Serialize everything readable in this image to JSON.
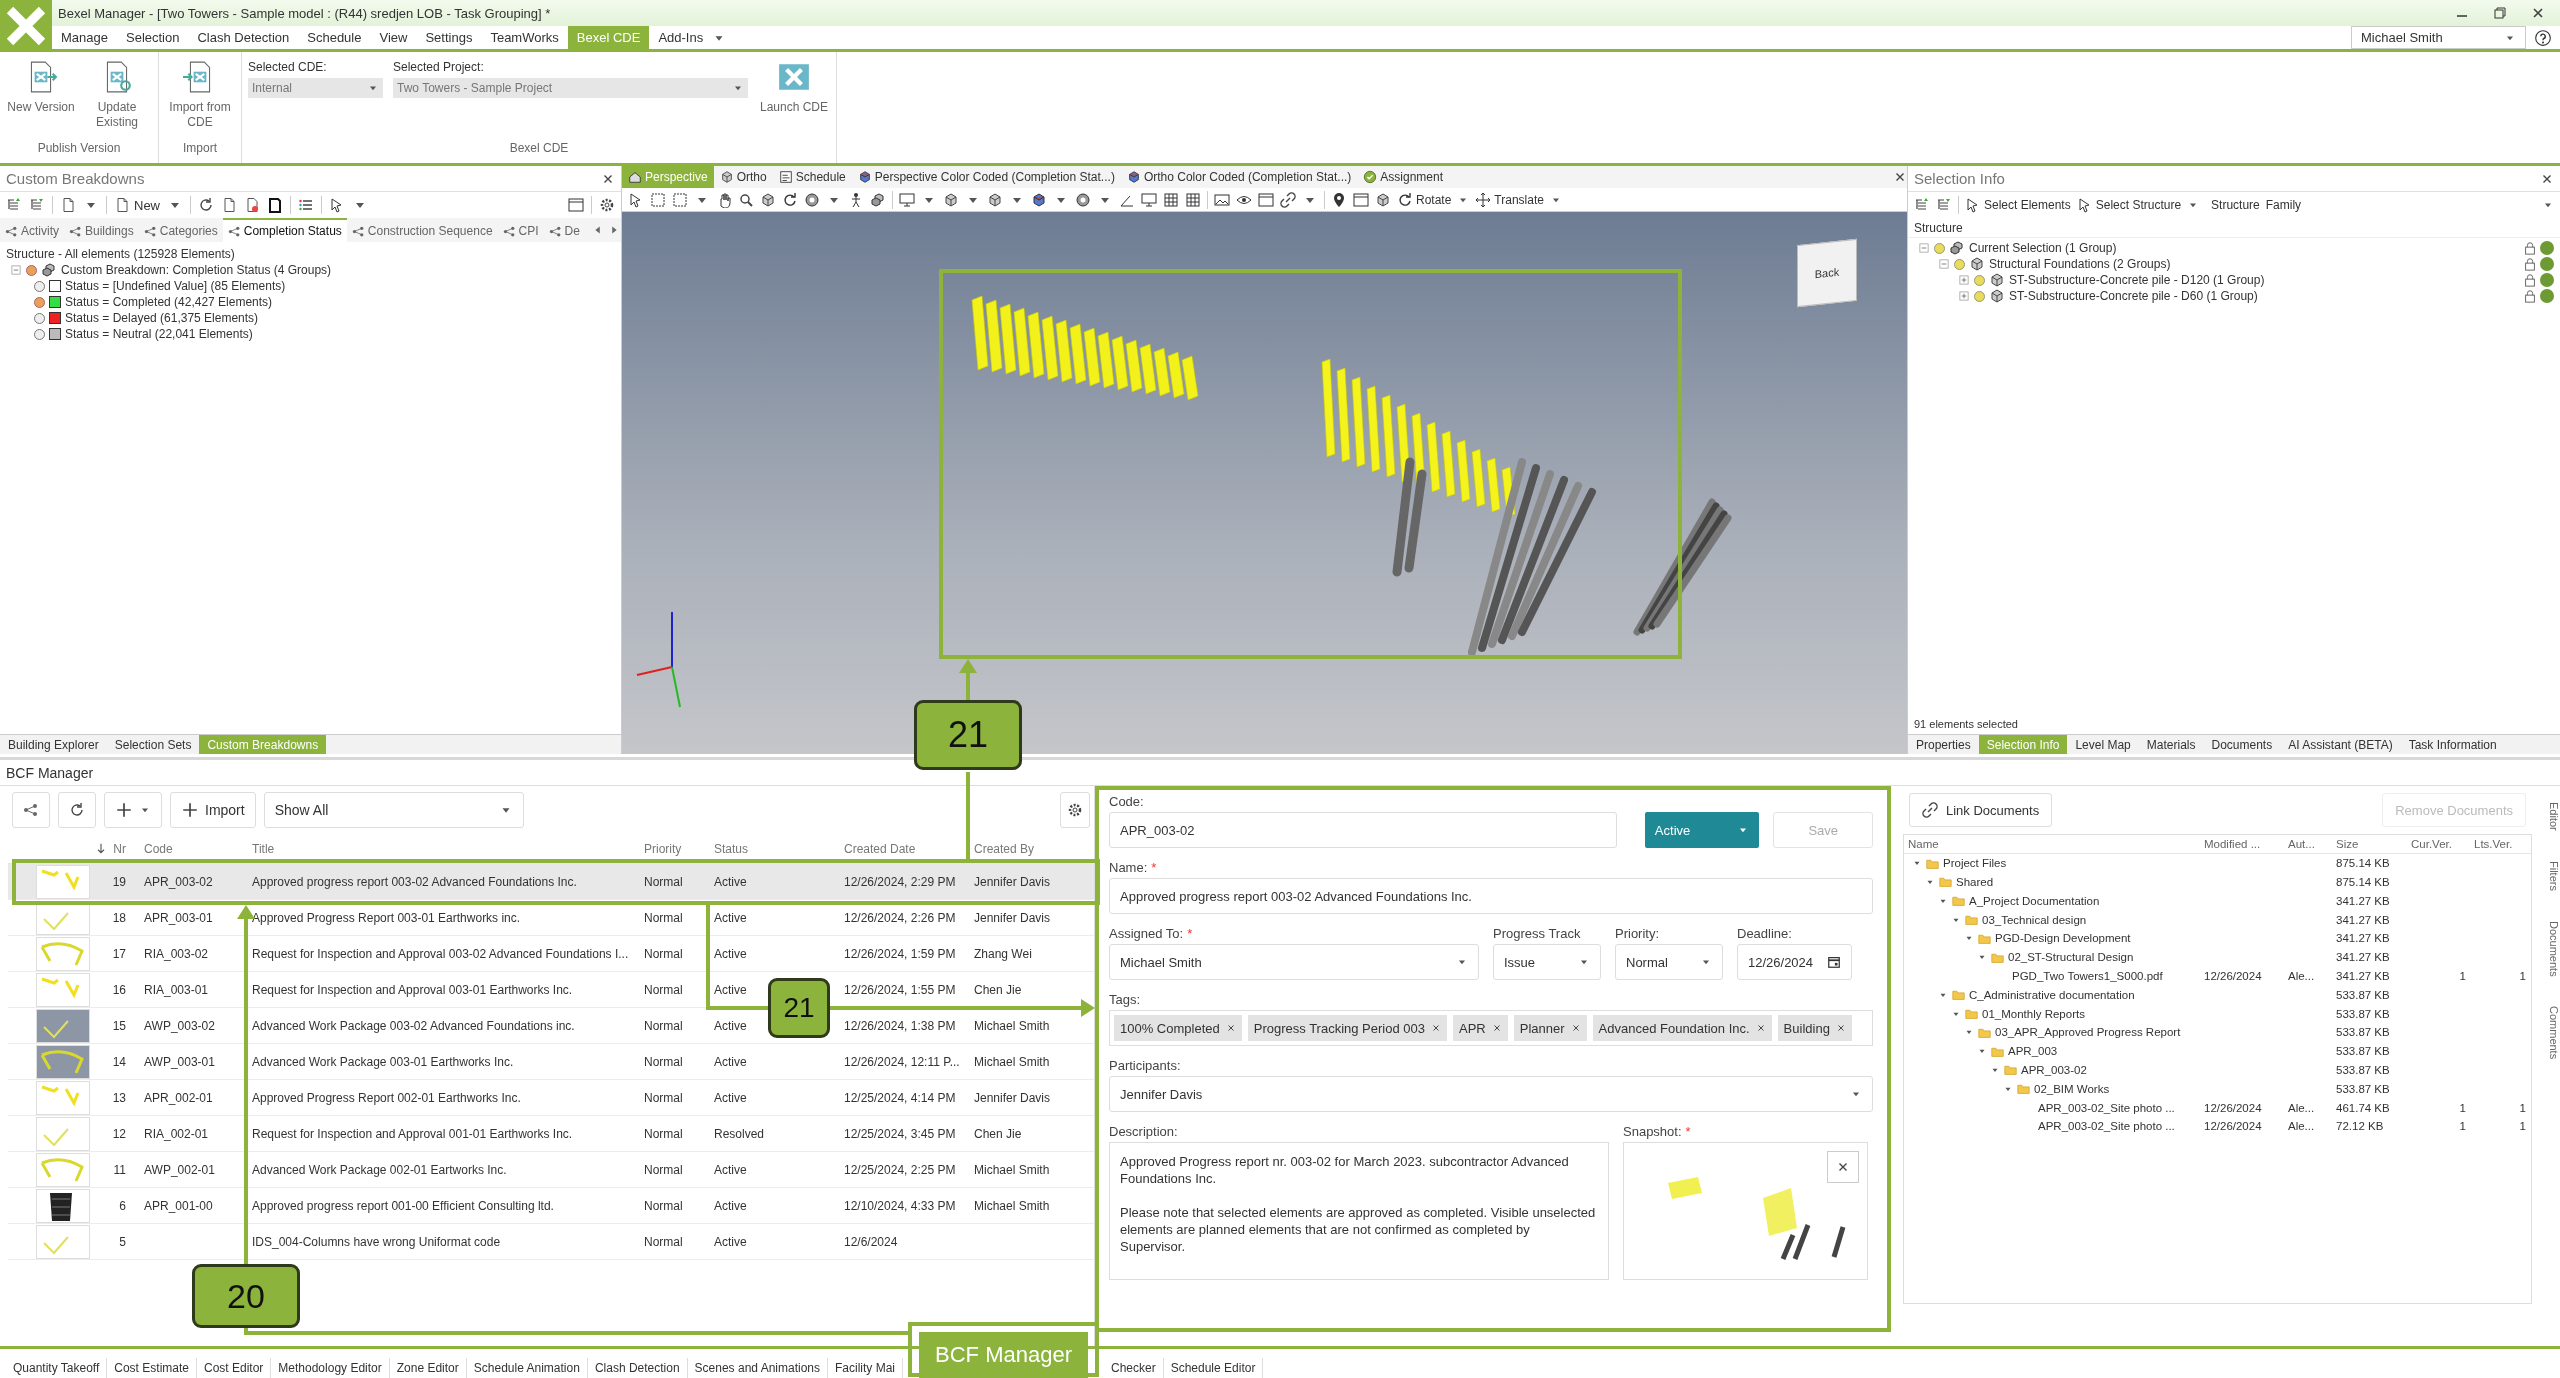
{
  "window": {
    "title": "Bexel Manager - [Two Towers - Sample model : (R44) sredjen LOB  - Task Grouping] *",
    "user": "Michael Smith"
  },
  "menu_tabs": [
    {
      "label": "Manage",
      "selected": false
    },
    {
      "label": "Selection",
      "selected": false
    },
    {
      "label": "Clash Detection",
      "selected": false
    },
    {
      "label": "Schedule",
      "selected": false
    },
    {
      "label": "View",
      "selected": false
    },
    {
      "label": "Settings",
      "selected": false
    },
    {
      "label": "TeamWorks",
      "selected": false
    },
    {
      "label": "Bexel CDE",
      "selected": true
    },
    {
      "label": "Add-Ins",
      "selected": false
    }
  ],
  "ribbon": {
    "groups": [
      {
        "label": "Publish Version",
        "buttons": [
          {
            "label": "New Version",
            "kind": "export"
          },
          {
            "label": "Update Existing",
            "kind": "update"
          }
        ]
      },
      {
        "label": "Import",
        "buttons": [
          {
            "label": "Import from CDE",
            "kind": "import"
          }
        ]
      }
    ],
    "cde_group": {
      "label": "Bexel CDE",
      "cde_label": "Selected CDE:",
      "cde": "Internal",
      "project_label": "Selected Project:",
      "project": "Two Towers - Sample Project",
      "launch": "Launch CDE"
    }
  },
  "custom_breakdowns": {
    "title": "Custom Breakdowns",
    "new_button": "New",
    "tabs": [
      {
        "label": "Activity",
        "selected": false
      },
      {
        "label": "Buildings",
        "selected": false
      },
      {
        "label": "Categories",
        "selected": false
      },
      {
        "label": "Completion Status",
        "selected": true
      },
      {
        "label": "Construction Sequence",
        "selected": false
      },
      {
        "label": "CPI",
        "selected": false
      },
      {
        "label": "De",
        "selected": false
      }
    ],
    "tree": {
      "label": "Structure - All elements (125928 Elements)",
      "children": [
        {
          "label": "Custom Breakdown: Completion Status (4 Groups)",
          "expanded": true,
          "visible": true,
          "children": [
            {
              "label": "Status = [Undefined Value] (85 Elements)",
              "color": "#ffffff",
              "visible": false
            },
            {
              "label": "Status = Completed (42,427 Elements)",
              "color": "#33dd44",
              "visible": true
            },
            {
              "label": "Status = Delayed (61,375 Elements)",
              "color": "#ee2222",
              "visible": false
            },
            {
              "label": "Status = Neutral (22,041 Elements)",
              "color": "#bbbbbb",
              "visible": false
            }
          ]
        }
      ]
    },
    "bottom_tabs": [
      {
        "label": "Building Explorer",
        "selected": false
      },
      {
        "label": "Selection Sets",
        "selected": false
      },
      {
        "label": "Custom Breakdowns",
        "selected": true
      }
    ]
  },
  "viewport": {
    "tabs": [
      {
        "label": "Perspective",
        "selected": true
      },
      {
        "label": "Ortho",
        "selected": false
      },
      {
        "label": "Schedule",
        "selected": false
      },
      {
        "label": "Perspective Color Coded (Completion Stat...)",
        "selected": false
      },
      {
        "label": "Ortho Color Coded (Completion Stat...)",
        "selected": false
      },
      {
        "label": "Assignment",
        "selected": false
      }
    ],
    "rotate": "Rotate",
    "translate": "Translate",
    "view_cube": "Back"
  },
  "selection_info": {
    "title": "Selection Info",
    "select_elements": "Select Elements",
    "select_structure": "Select Structure",
    "structure_label": "Structure",
    "structure_value": "Family",
    "column": "Structure",
    "tree": {
      "label": "Current Selection (1 Group)",
      "expanded": true,
      "children": [
        {
          "label": "Structural Foundations (2 Groups)",
          "expanded": true,
          "children": [
            {
              "label": "ST-Substructure-Concrete pile - D120 (1 Group)",
              "expanded": false
            },
            {
              "label": "ST-Substructure-Concrete pile - D60 (1 Group)",
              "expanded": false
            }
          ]
        }
      ]
    },
    "status": "91 elements selected",
    "bottom_tabs": [
      {
        "label": "Properties",
        "selected": false
      },
      {
        "label": "Selection Info",
        "selected": true
      },
      {
        "label": "Level Map",
        "selected": false
      },
      {
        "label": "Materials",
        "selected": false
      },
      {
        "label": "Documents",
        "selected": false
      },
      {
        "label": "AI Assistant (BETA)",
        "selected": false
      },
      {
        "label": "Task Information",
        "selected": false
      }
    ]
  },
  "bcf": {
    "title": "BCF Manager",
    "import": "Import",
    "filter": "Show All",
    "columns": [
      "Nr",
      "Code",
      "Title",
      "Priority",
      "Status",
      "Created Date",
      "Created By"
    ],
    "rows": [
      {
        "nr": "19",
        "code": "APR_003-02",
        "title": "Approved progress report 003-02 Advanced Foundations Inc.",
        "priority": "Normal",
        "status": "Active",
        "created_date": "12/26/2024, 2:29 PM",
        "created_by": "Jennifer Davis",
        "selected": true
      },
      {
        "nr": "18",
        "code": "APR_003-01",
        "title": "Approved Progress Report 003-01 Earthworks inc.",
        "priority": "Normal",
        "status": "Active",
        "created_date": "12/26/2024, 2:26 PM",
        "created_by": "Jennifer Davis",
        "selected": false
      },
      {
        "nr": "17",
        "code": "RIA_003-02",
        "title": "Request for Inspection and Approval 003-02 Advanced Foundations I...",
        "priority": "Normal",
        "status": "Active",
        "created_date": "12/26/2024, 1:59 PM",
        "created_by": "Zhang Wei",
        "selected": false
      },
      {
        "nr": "16",
        "code": "RIA_003-01",
        "title": "Request for Inspection and Approval 003-01 Earthworks Inc.",
        "priority": "Normal",
        "status": "Active",
        "created_date": "12/26/2024, 1:55 PM",
        "created_by": "Chen Jie",
        "selected": false
      },
      {
        "nr": "15",
        "code": "AWP_003-02",
        "title": "Advanced Work Package 003-02 Advanced Foundations inc.",
        "priority": "Normal",
        "status": "Active",
        "created_date": "12/26/2024, 1:38 PM",
        "created_by": "Michael Smith",
        "selected": false
      },
      {
        "nr": "14",
        "code": "AWP_003-01",
        "title": "Advanced Work Package 003-01 Earthworks Inc.",
        "priority": "Normal",
        "status": "Active",
        "created_date": "12/26/2024, 12:11 P...",
        "created_by": "Michael Smith",
        "selected": false
      },
      {
        "nr": "13",
        "code": "APR_002-01",
        "title": "Approved Progress Report 002-01 Earthworks Inc.",
        "priority": "Normal",
        "status": "Active",
        "created_date": "12/25/2024, 4:14 PM",
        "created_by": "Jennifer Davis",
        "selected": false
      },
      {
        "nr": "12",
        "code": "RIA_002-01",
        "title": "Request for Inspection and Approval 001-01 Earthworks Inc.",
        "priority": "Normal",
        "status": "Resolved",
        "created_date": "12/25/2024, 3:45 PM",
        "created_by": "Chen Jie",
        "selected": false
      },
      {
        "nr": "11",
        "code": "AWP_002-01",
        "title": "Advanced Work Package 002-01 Eartworks Inc.",
        "priority": "Normal",
        "status": "Active",
        "created_date": "12/25/2024, 2:25 PM",
        "created_by": "Michael Smith",
        "selected": false
      },
      {
        "nr": "6",
        "code": "APR_001-00",
        "title": "Approved progress report 001-00 Efficient Consulting ltd.",
        "priority": "Normal",
        "status": "Active",
        "created_date": "12/10/2024, 4:33 PM",
        "created_by": "Michael Smith",
        "selected": false
      },
      {
        "nr": "5",
        "title": "IDS_004-Columns have wrong Uniformat code",
        "priority": "Normal",
        "status": "Active",
        "created_date": "12/6/2024",
        "selected": false
      }
    ]
  },
  "issue_form": {
    "code_label": {
      "text": "Code:"
    },
    "code": "APR_003-02",
    "status": "Active",
    "save": "Save",
    "name_label": {
      "text": "Name:",
      "required_mark": "*"
    },
    "name": "Approved progress report 003-02 Advanced Foundations Inc.",
    "assigned_label": {
      "text": "Assigned To:",
      "required_mark": "*"
    },
    "assigned": "Michael Smith",
    "progress_label": {
      "text": "Progress Track"
    },
    "progress": "Issue",
    "priority_label": {
      "text": "Priority:"
    },
    "priority": "Normal",
    "deadline_label": {
      "text": "Deadline:"
    },
    "deadline": "12/26/2024",
    "tags_label": {
      "text": "Tags:"
    },
    "tags": [
      "100% Completed",
      "Progress Tracking Period 003",
      "APR",
      "Planner",
      "Advanced Foundation Inc.",
      "Building"
    ],
    "participants_label": {
      "text": "Participants:"
    },
    "participants": "Jennifer Davis",
    "description_label": {
      "text": "Description:"
    },
    "description": [
      "Approved Progress report nr. 003-02 for March 2023. subcontractor Advanced Foundations Inc.",
      "Please note that selected elements are approved as completed. Visible unselected elements are planned elements that are not confirmed as completed by Supervisor."
    ],
    "snapshot_label": {
      "text": "Snapshot:",
      "required_mark": "*"
    }
  },
  "documents": {
    "link": "Link Documents",
    "remove": "Remove Documents",
    "remove_disabled": true,
    "columns": [
      "Name",
      "Modified ...",
      "Aut...",
      "Size",
      "Cur.Ver.",
      "Lts.Ver."
    ],
    "tree": [
      {
        "name": "Project Files",
        "kind": "folder",
        "size": "875.14 KB",
        "expanded": true,
        "children": [
          {
            "name": "Shared",
            "kind": "folder",
            "size": "875.14 KB",
            "expanded": true,
            "children": [
              {
                "name": "A_Project Documentation",
                "kind": "folder",
                "size": "341.27 KB",
                "expanded": true,
                "children": [
                  {
                    "name": "03_Technical design",
                    "kind": "folder",
                    "size": "341.27 KB",
                    "expanded": true,
                    "children": [
                      {
                        "name": "PGD-Design Development",
                        "kind": "folder",
                        "size": "341.27 KB",
                        "expanded": true,
                        "children": [
                          {
                            "name": "02_ST-Structural Design",
                            "kind": "folder",
                            "size": "341.27 KB",
                            "expanded": true,
                            "children": [
                              {
                                "name": "PGD_Two Towers1_S000.pdf",
                                "kind": "file",
                                "modified": "12/26/2024",
                                "author": "Ale...",
                                "size": "341.27 KB",
                                "cur": "1",
                                "lts": "1"
                              }
                            ]
                          }
                        ]
                      }
                    ]
                  }
                ]
              },
              {
                "name": "C_Administrative documentation",
                "kind": "folder",
                "size": "533.87 KB",
                "expanded": true,
                "children": [
                  {
                    "name": "01_Monthly Reports",
                    "kind": "folder",
                    "size": "533.87 KB",
                    "expanded": true,
                    "children": [
                      {
                        "name": "03_APR_Approved Progress Report",
                        "kind": "folder",
                        "size": "533.87 KB",
                        "expanded": true,
                        "children": [
                          {
                            "name": "APR_003",
                            "kind": "folder",
                            "size": "533.87 KB",
                            "expanded": true,
                            "children": [
                              {
                                "name": "APR_003-02",
                                "kind": "folder",
                                "size": "533.87 KB",
                                "expanded": true,
                                "children": [
                                  {
                                    "name": "02_BIM Works",
                                    "kind": "folder",
                                    "size": "533.87 KB",
                                    "expanded": true,
                                    "children": [
                                      {
                                        "name": "APR_003-02_Site photo ...",
                                        "kind": "file",
                                        "modified": "12/26/2024",
                                        "author": "Ale...",
                                        "size": "461.74 KB",
                                        "cur": "1",
                                        "lts": "1"
                                      },
                                      {
                                        "name": "APR_003-02_Site photo ...",
                                        "kind": "file",
                                        "modified": "12/26/2024",
                                        "author": "Ale...",
                                        "size": "72.12 KB",
                                        "cur": "1",
                                        "lts": "1"
                                      }
                                    ]
                                  }
                                ]
                              }
                            ]
                          }
                        ]
                      }
                    ]
                  }
                ]
              }
            ]
          }
        ]
      }
    ],
    "side_tabs": [
      "Editor",
      "Filters",
      "Documents",
      "Comments"
    ]
  },
  "bottom_tabs": [
    {
      "label": "Quantity Takeoff",
      "selected": false
    },
    {
      "label": "Cost Estimate",
      "selected": false
    },
    {
      "label": "Cost Editor",
      "selected": false
    },
    {
      "label": "Methodology Editor",
      "selected": false
    },
    {
      "label": "Zone Editor",
      "selected": false
    },
    {
      "label": "Schedule Animation",
      "selected": false
    },
    {
      "label": "Clash Detection",
      "selected": false
    },
    {
      "label": "Scenes and Animations",
      "selected": false
    },
    {
      "label": "Facility Mai",
      "selected": false
    },
    {
      "label": "BCF Manager",
      "selected": true
    },
    {
      "label": "Checker",
      "selected": false
    },
    {
      "label": "Schedule Editor",
      "selected": false
    }
  ],
  "annotations": {
    "callouts": [
      {
        "label": "21"
      },
      {
        "label": "21"
      },
      {
        "label": "20"
      }
    ]
  }
}
